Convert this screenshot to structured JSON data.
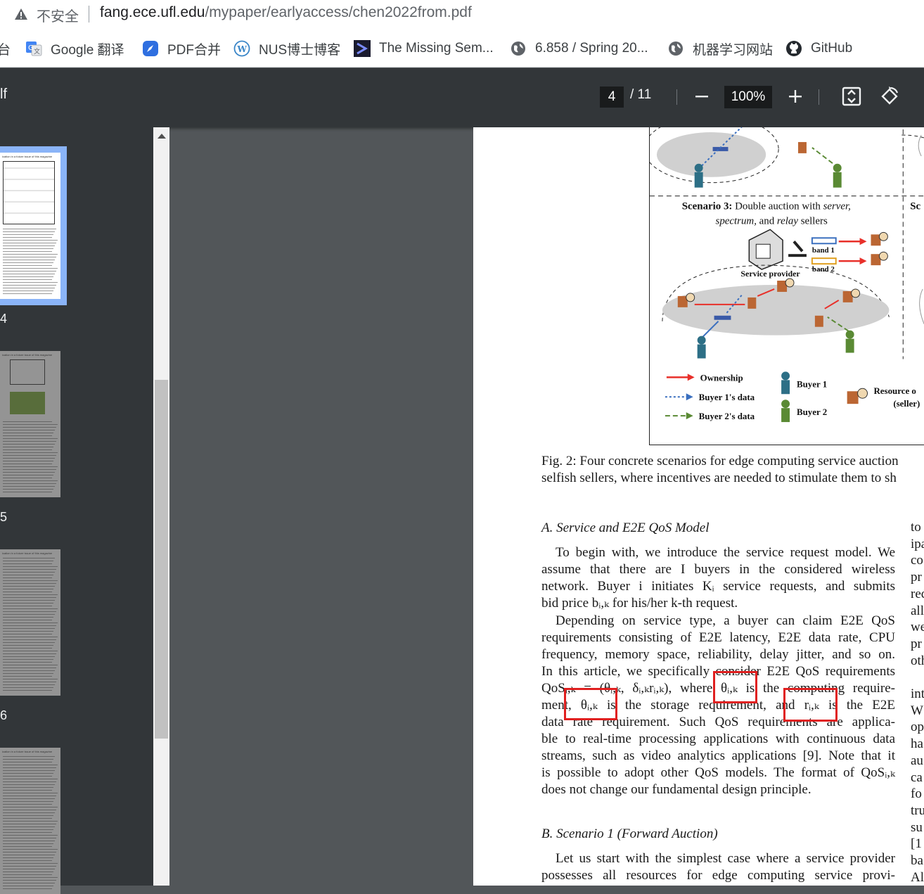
{
  "address_bar": {
    "security": "不安全",
    "url_host": "fang.ece.ufl.edu",
    "url_path": "/mypaper/earlyaccess/chen2022from.pdf"
  },
  "bookmarks": [
    {
      "label": "台",
      "icon": "cut-off"
    },
    {
      "label": "Google 翻译",
      "icon": "google-translate-icon"
    },
    {
      "label": "PDF合并",
      "icon": "rocket-icon"
    },
    {
      "label": "NUS博士博客",
      "icon": "wordpress-icon"
    },
    {
      "label": "The Missing Sem...",
      "icon": "terminal-icon"
    },
    {
      "label": "6.858 / Spring 20...",
      "icon": "globe-icon"
    },
    {
      "label": "机器学习网站",
      "icon": "globe-icon"
    },
    {
      "label": "GitHub",
      "icon": "github-icon"
    }
  ],
  "pdf_toolbar": {
    "title": "lf",
    "page_current": "4",
    "page_total": "/ 11",
    "zoom": "100%"
  },
  "sidebar": {
    "pages": [
      {
        "label": "4",
        "header": "ication in a future issue of this magazine",
        "selected": true
      },
      {
        "label": "5",
        "header": "ication in a future issue of this magazine",
        "selected": false
      },
      {
        "label": "6",
        "header": "ication in a future issue of this magazine",
        "selected": false
      },
      {
        "label": "",
        "header": "ication in a future issue of this magazine",
        "selected": false
      }
    ]
  },
  "figure": {
    "scenario3_title_bold": "Scenario 3:",
    "scenario3_title_rest": "Double auction with",
    "scenario3_server": "server,",
    "scenario3_spectrum": "spectrum,",
    "scenario3_and": "and",
    "scenario3_relay": "relay",
    "scenario3_sellers": "sellers",
    "scenario4_cut": "Sc",
    "band1": "band 1",
    "band2": "band 2",
    "service_provider": "Service provider",
    "legend": {
      "ownership": "Ownership",
      "buyer1_data": "Buyer 1's data",
      "buyer2_data": "Buyer 2's data",
      "buyer1": "Buyer 1",
      "buyer2": "Buyer 2",
      "resource_owner": "Resource o",
      "seller": "(seller)"
    },
    "colors": {
      "ownership": "#e8302a",
      "buyer1": "#2d6f86",
      "buyer2": "#5a8a34",
      "data_blue": "#3a6fbf",
      "ellipse": "#d0d0d0"
    }
  },
  "caption": {
    "line1": "Fig. 2: Four concrete scenarios for edge computing service auction",
    "line2": "selfish sellers, where incentives are needed to stimulate them to sh"
  },
  "section_a": {
    "heading": "A.  Service and E2E QoS Model",
    "p1": [
      "To begin with, we introduce the service request model. We",
      "assume that there are I buyers in the considered wireless",
      "network. Buyer i initiates Kᵢ service requests, and submits",
      "bid price bᵢ,ₖ for his/her k-th request."
    ],
    "p2": [
      "Depending on service type, a buyer can claim E2E QoS",
      "requirements consisting of E2E latency, E2E data rate, CPU",
      "frequency, memory space, reliability, delay jitter, and so on.",
      "In this article, we specifically consider E2E QoS requirements",
      "QoSᵢ,ₖ = (θᵢ,ₖ, δᵢ,ₖrᵢ,ₖ), where θᵢ,ₖ is the computing require-",
      "ment, θᵢ,ₖ is the storage requirement, and rᵢ,ₖ is the E2E",
      "data rate requirement. Such QoS requirements are applica-",
      "ble to real-time processing applications with continuous data",
      "streams, such as video analytics applications [9]. Note that it",
      "is possible to adopt other QoS models. The format of QoSᵢ,ₖ",
      "does not change our fundamental design principle."
    ]
  },
  "section_b": {
    "heading": "B.  Scenario 1 (Forward Auction)",
    "p1": [
      "Let us start with the simplest case where a service provider",
      "possesses all resources for edge computing service provi-"
    ]
  },
  "right_column": [
    "to",
    "ipa",
    "co",
    "pr",
    "rec",
    "all",
    "we",
    "pr",
    "oth",
    "",
    "int",
    "W",
    "op",
    "ha",
    "au",
    "ca",
    "fo",
    "tru",
    "su",
    "[1",
    "ba",
    "Al"
  ]
}
